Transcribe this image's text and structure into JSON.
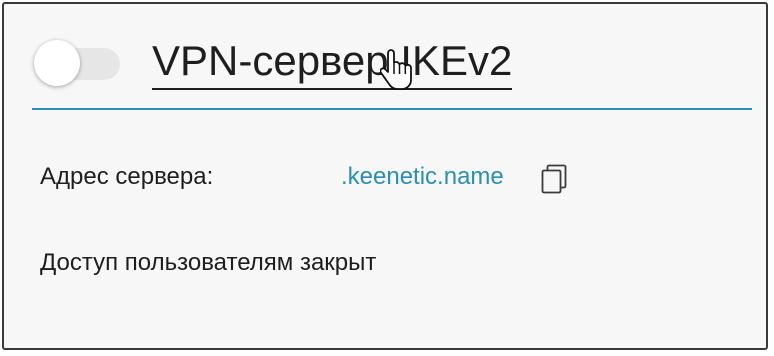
{
  "server": {
    "title": "VPN-сервер IKEv2",
    "toggle_on": false,
    "address_label": "Адрес сервера:",
    "address_value": ".keenetic.name",
    "access_status": "Доступ пользователям закрыт"
  },
  "icons": {
    "toggle": "toggle-switch",
    "copy": "copy-icon",
    "cursor": "hand-pointer-icon"
  },
  "colors": {
    "accent": "#2a8fb1",
    "text": "#1e1e1e",
    "border": "#3a3a3a"
  }
}
